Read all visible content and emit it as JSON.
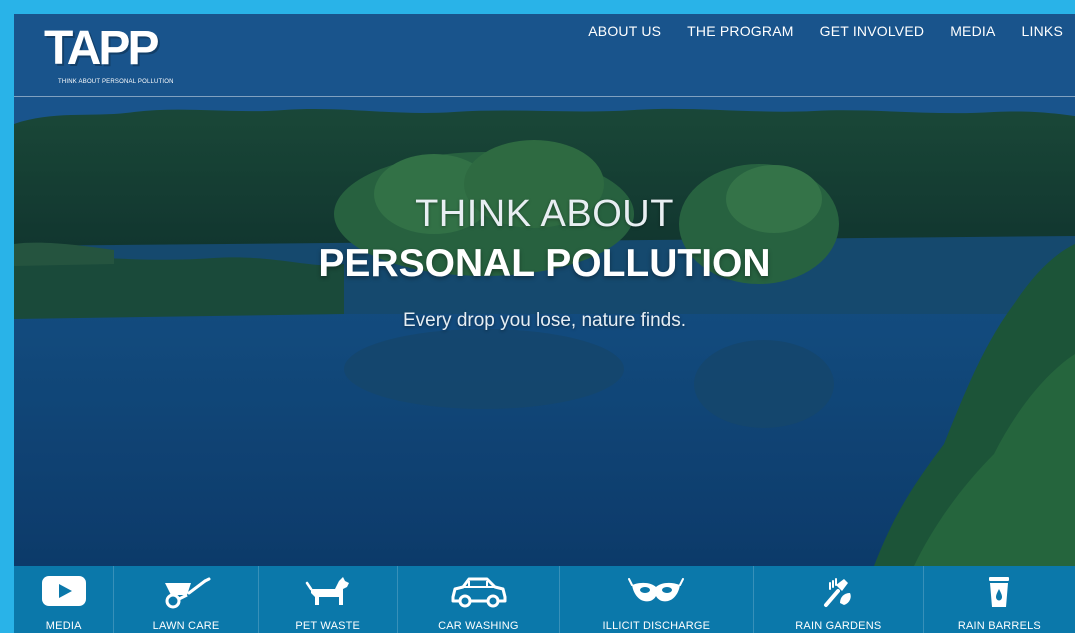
{
  "logo": {
    "wordmark": "TAPP",
    "tagline": "THINK ABOUT PERSONAL POLLUTION"
  },
  "nav": {
    "items": [
      {
        "label": "ABOUT US"
      },
      {
        "label": "THE PROGRAM"
      },
      {
        "label": "GET INVOLVED"
      },
      {
        "label": "MEDIA"
      },
      {
        "label": "LINKS"
      }
    ]
  },
  "hero": {
    "line1": "THINK ABOUT",
    "line2": "PERSONAL POLLUTION",
    "tagline": "Every drop you lose, nature finds."
  },
  "iconbar": {
    "items": [
      {
        "label": "MEDIA",
        "icon": "play-icon"
      },
      {
        "label": "LAWN CARE",
        "icon": "wheelbarrow-icon"
      },
      {
        "label": "PET WASTE",
        "icon": "dog-icon"
      },
      {
        "label": "CAR WASHING",
        "icon": "car-icon"
      },
      {
        "label": "ILLICIT DISCHARGE",
        "icon": "mask-icon"
      },
      {
        "label": "RAIN GARDENS",
        "icon": "garden-tools-icon"
      },
      {
        "label": "RAIN BARRELS",
        "icon": "barrel-icon"
      }
    ]
  },
  "colors": {
    "page_border": "#29b3e8",
    "icon_bar": "#0b78aa",
    "text": "#ffffff"
  }
}
